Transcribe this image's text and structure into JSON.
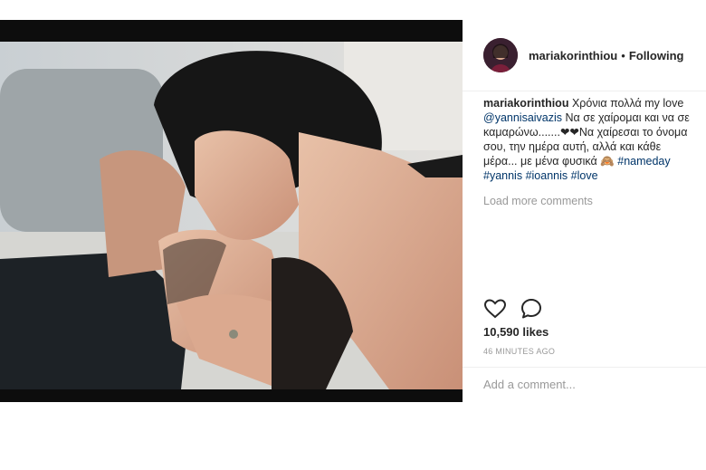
{
  "post": {
    "username": "mariakorinthiou",
    "separator": "•",
    "follow_status": "Following",
    "caption": {
      "user": "mariakorinthiou",
      "line1_text": " Χρόνια πολλά my love",
      "line2_mention": "@yannisaivazis",
      "line2_text": " Να σε χαίρομαι και να σε",
      "line3_text": "καμαρώνω.......❤❤Να χαίρεσαι το όνομα",
      "line4_text": "σου, την ημέρα αυτή, αλλά και κάθε",
      "line5_text": "μέρα... με μένα φυσικά 🙈 ",
      "line5_tag": "#nameday",
      "line6_tag1": "#yannis",
      "line6_tag2": "#ioannis",
      "line6_tag3": "#love"
    },
    "load_more": "Load more comments",
    "likes": "10,590 likes",
    "timestamp": "46 MINUTES AGO",
    "comment_placeholder": "Add a comment..."
  },
  "icons": {
    "like": "heart-icon",
    "comment": "comment-bubble-icon"
  },
  "colors": {
    "text": "#262626",
    "muted": "#999999",
    "link": "#003569",
    "photo_letterbox": "#0d0d0d"
  }
}
